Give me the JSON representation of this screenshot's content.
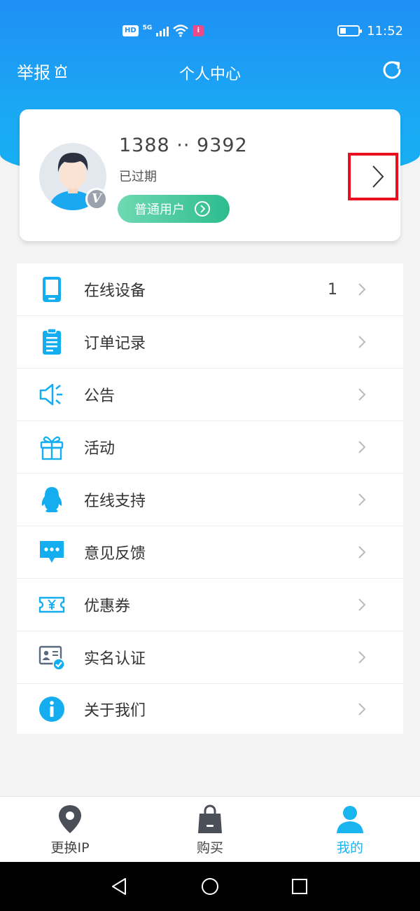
{
  "status_bar": {
    "hd": "HD",
    "network": "5G",
    "time": "11:52"
  },
  "header": {
    "report_label": "举报",
    "title": "个人中心"
  },
  "profile": {
    "phone": "1388 ·· 9392",
    "status": "已过期",
    "user_type": "普通用户",
    "badge_letter": "V"
  },
  "menu": [
    {
      "label": "在线设备",
      "count": "1",
      "icon": "tablet-icon"
    },
    {
      "label": "订单记录",
      "count": "",
      "icon": "clipboard-icon"
    },
    {
      "label": "公告",
      "count": "",
      "icon": "speaker-icon"
    },
    {
      "label": "活动",
      "count": "",
      "icon": "gift-icon"
    },
    {
      "label": "在线支持",
      "count": "",
      "icon": "penguin-icon"
    },
    {
      "label": "意见反馈",
      "count": "",
      "icon": "chat-bubble-icon"
    },
    {
      "label": "优惠券",
      "count": "",
      "icon": "coupon-icon"
    },
    {
      "label": "实名认证",
      "count": "",
      "icon": "id-card-icon"
    },
    {
      "label": "关于我们",
      "count": "",
      "icon": "info-icon"
    }
  ],
  "tabs": [
    {
      "label": "更换IP",
      "icon": "location-pin-icon"
    },
    {
      "label": "购买",
      "icon": "shopping-bag-icon"
    },
    {
      "label": "我的",
      "icon": "person-icon"
    }
  ],
  "colors": {
    "accent": "#1ab4ef",
    "header_blue": "#1f8ff5",
    "pill_green": "#2dbc8e",
    "highlight_red": "#e8101f"
  }
}
